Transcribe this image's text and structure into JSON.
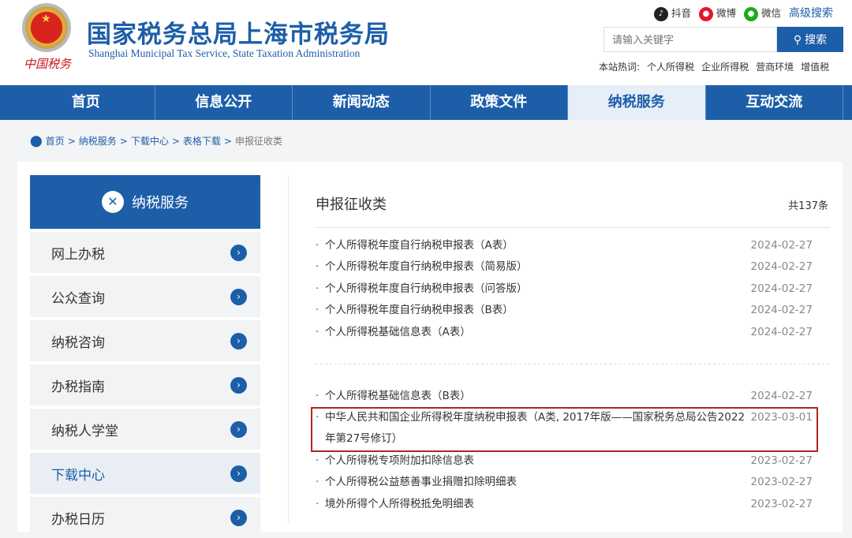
{
  "header": {
    "title_cn": "国家税务总局上海市税务局",
    "title_en": "Shanghai Municipal Tax Service, State Taxation Administration",
    "seal_text": "中国税务",
    "social": [
      {
        "label": "抖音",
        "icon": "douyin-icon",
        "color": "#222222"
      },
      {
        "label": "微博",
        "icon": "weibo-icon",
        "color": "#e6162d"
      },
      {
        "label": "微信",
        "icon": "wechat-icon",
        "color": "#1aad19"
      }
    ],
    "advanced_search": "高级搜索",
    "search_placeholder": "请输入关键字",
    "search_button": "搜索",
    "hot_label": "本站热词:",
    "hot_words": [
      "个人所得税",
      "企业所得税",
      "营商环境",
      "增值税"
    ]
  },
  "nav": [
    "首页",
    "信息公开",
    "新闻动态",
    "政策文件",
    "纳税服务",
    "互动交流"
  ],
  "nav_active": 4,
  "breadcrumb": [
    "首页",
    "纳税服务",
    "下载中心",
    "表格下载",
    "申报征收类"
  ],
  "sidebar": {
    "title": "纳税服务",
    "items": [
      "网上办税",
      "公众查询",
      "纳税咨询",
      "办税指南",
      "纳税人学堂",
      "下载中心",
      "办税日历"
    ],
    "active": 5
  },
  "main": {
    "title": "申报征收类",
    "count": "共137条",
    "group1": [
      {
        "title": "个人所得税年度自行纳税申报表（A表）",
        "date": "2024-02-27"
      },
      {
        "title": "个人所得税年度自行纳税申报表（简易版）",
        "date": "2024-02-27"
      },
      {
        "title": "个人所得税年度自行纳税申报表（问答版）",
        "date": "2024-02-27"
      },
      {
        "title": "个人所得税年度自行纳税申报表（B表）",
        "date": "2024-02-27"
      },
      {
        "title": "个人所得税基础信息表（A表）",
        "date": "2024-02-27"
      }
    ],
    "group2": [
      {
        "title": "个人所得税基础信息表（B表）",
        "date": "2024-02-27"
      },
      {
        "title": "中华人民共和国企业所得税年度纳税申报表（A类, 2017年版——国家税务总局公告2022年第27号修订）",
        "date": "2023-03-01"
      },
      {
        "title": "个人所得税专项附加扣除信息表",
        "date": "2023-02-27"
      },
      {
        "title": "个人所得税公益慈善事业捐赠扣除明细表",
        "date": "2023-02-27"
      },
      {
        "title": "境外所得个人所得税抵免明细表",
        "date": "2023-02-27"
      }
    ]
  }
}
